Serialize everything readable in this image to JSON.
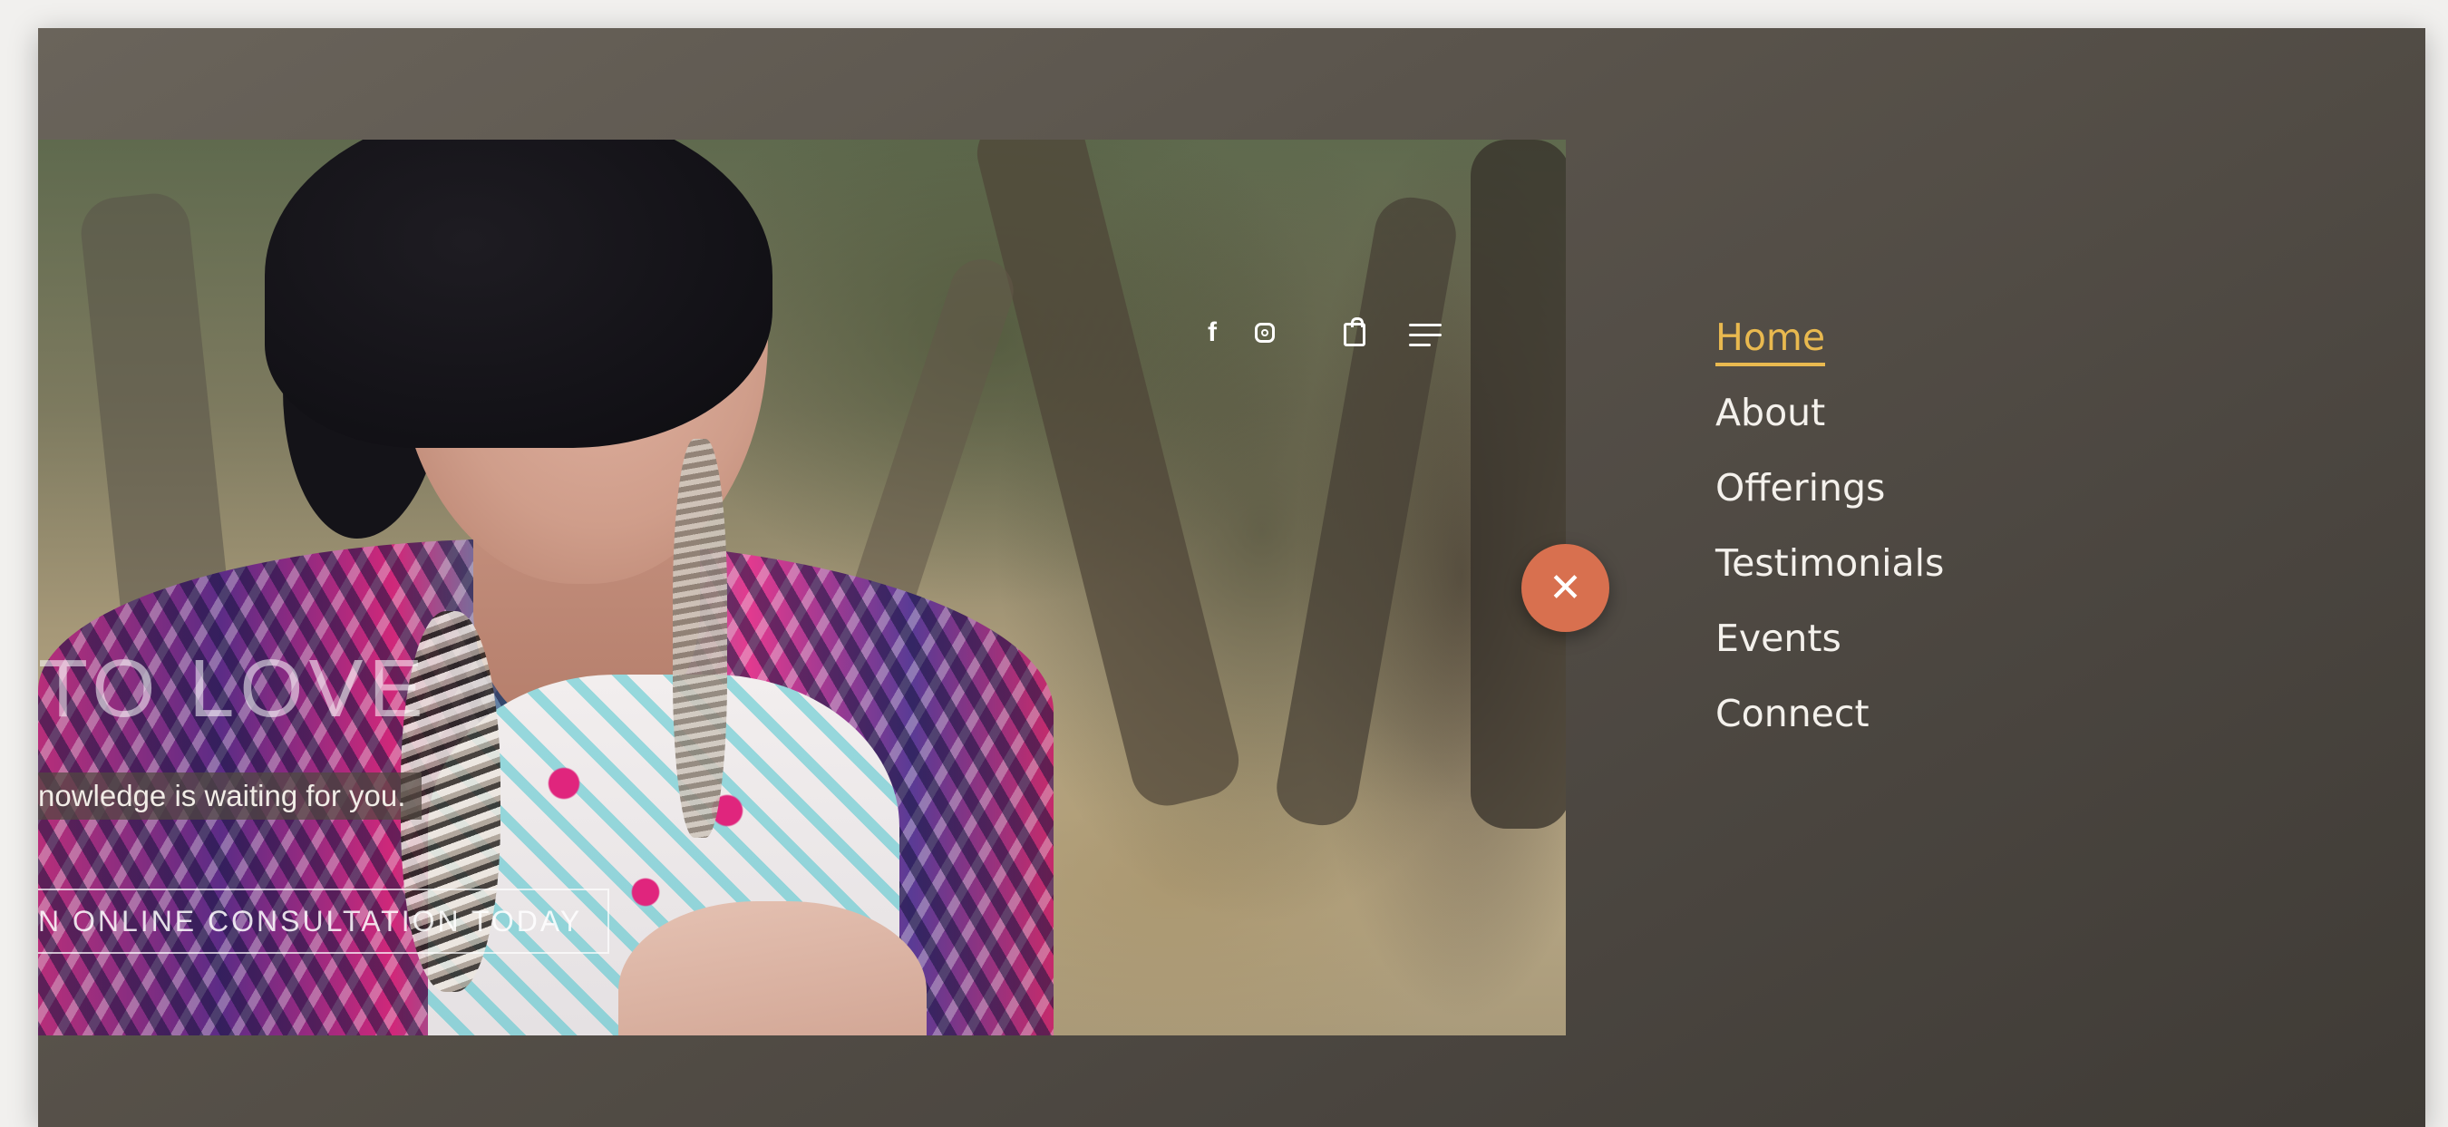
{
  "hero": {
    "title": "TO LOVE",
    "subtitle": "nowledge is waiting for you.",
    "cta_label": "N ONLINE CONSULTATION TODAY"
  },
  "header_icons": {
    "facebook": "facebook-icon",
    "instagram": "instagram-icon",
    "cart": "shopping-bag-icon",
    "menu": "hamburger-menu-icon"
  },
  "close_button": {
    "glyph": "✕",
    "icon": "close-icon"
  },
  "nav": {
    "items": [
      {
        "label": "Home",
        "active": true
      },
      {
        "label": "About",
        "active": false
      },
      {
        "label": "Offerings",
        "active": false
      },
      {
        "label": "Testimonials",
        "active": false
      },
      {
        "label": "Events",
        "active": false
      },
      {
        "label": "Connect",
        "active": false
      }
    ]
  },
  "colors": {
    "accent": "#e9b94f",
    "close_button": "#d8704f",
    "nav_text": "#f4f1ec",
    "overlay_bg": "#55504a"
  }
}
